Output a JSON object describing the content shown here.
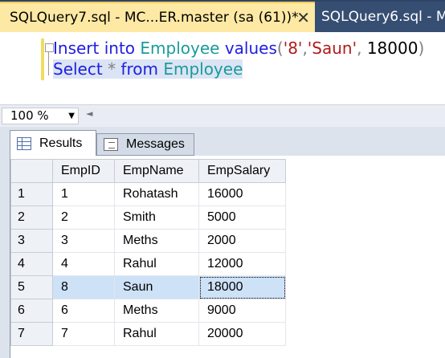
{
  "tabs": {
    "active_title": "SQLQuery7.sql - MC...ER.master (sa (61))*",
    "close_glyph": "✕",
    "inactive_title": "SQLQuery6.sql - M"
  },
  "editor": {
    "line1": {
      "kw_insert": "Insert",
      "kw_into": "into",
      "table": "Employee",
      "kw_values": "values",
      "open": "(",
      "v1": "'8'",
      "comma1": ",",
      "v2": "'Saun'",
      "comma2": ",",
      "v3": "18000",
      "close": ")"
    },
    "line2": {
      "kw_select": "Select",
      "star": "*",
      "kw_from": "from",
      "table": "Employee"
    }
  },
  "zoom": {
    "value": "100 %",
    "arrow": "▼",
    "scroll_arrow": "◄"
  },
  "results_tabs": {
    "results": "Results",
    "messages": "Messages"
  },
  "grid": {
    "columns": [
      "EmpID",
      "EmpName",
      "EmpSalary"
    ],
    "rows": [
      {
        "num": "1",
        "EmpID": "1",
        "EmpName": "Rohatash",
        "EmpSalary": "16000"
      },
      {
        "num": "2",
        "EmpID": "2",
        "EmpName": "Smith",
        "EmpSalary": "5000"
      },
      {
        "num": "3",
        "EmpID": "3",
        "EmpName": "Meths",
        "EmpSalary": "2000"
      },
      {
        "num": "4",
        "EmpID": "4",
        "EmpName": "Rahul",
        "EmpSalary": "12000"
      },
      {
        "num": "5",
        "EmpID": "8",
        "EmpName": "Saun",
        "EmpSalary": "18000"
      },
      {
        "num": "6",
        "EmpID": "6",
        "EmpName": "Meths",
        "EmpSalary": "9000"
      },
      {
        "num": "7",
        "EmpID": "7",
        "EmpName": "Rahul",
        "EmpSalary": "20000"
      }
    ],
    "selected_row": 4
  },
  "colors": {
    "tab_strip": "#2e4466",
    "active_tab": "#fde9a4",
    "keyword": "#1e1ee0",
    "object": "#1a9b9b",
    "string": "#b01c1c",
    "selected_row": "#cde1f7"
  }
}
